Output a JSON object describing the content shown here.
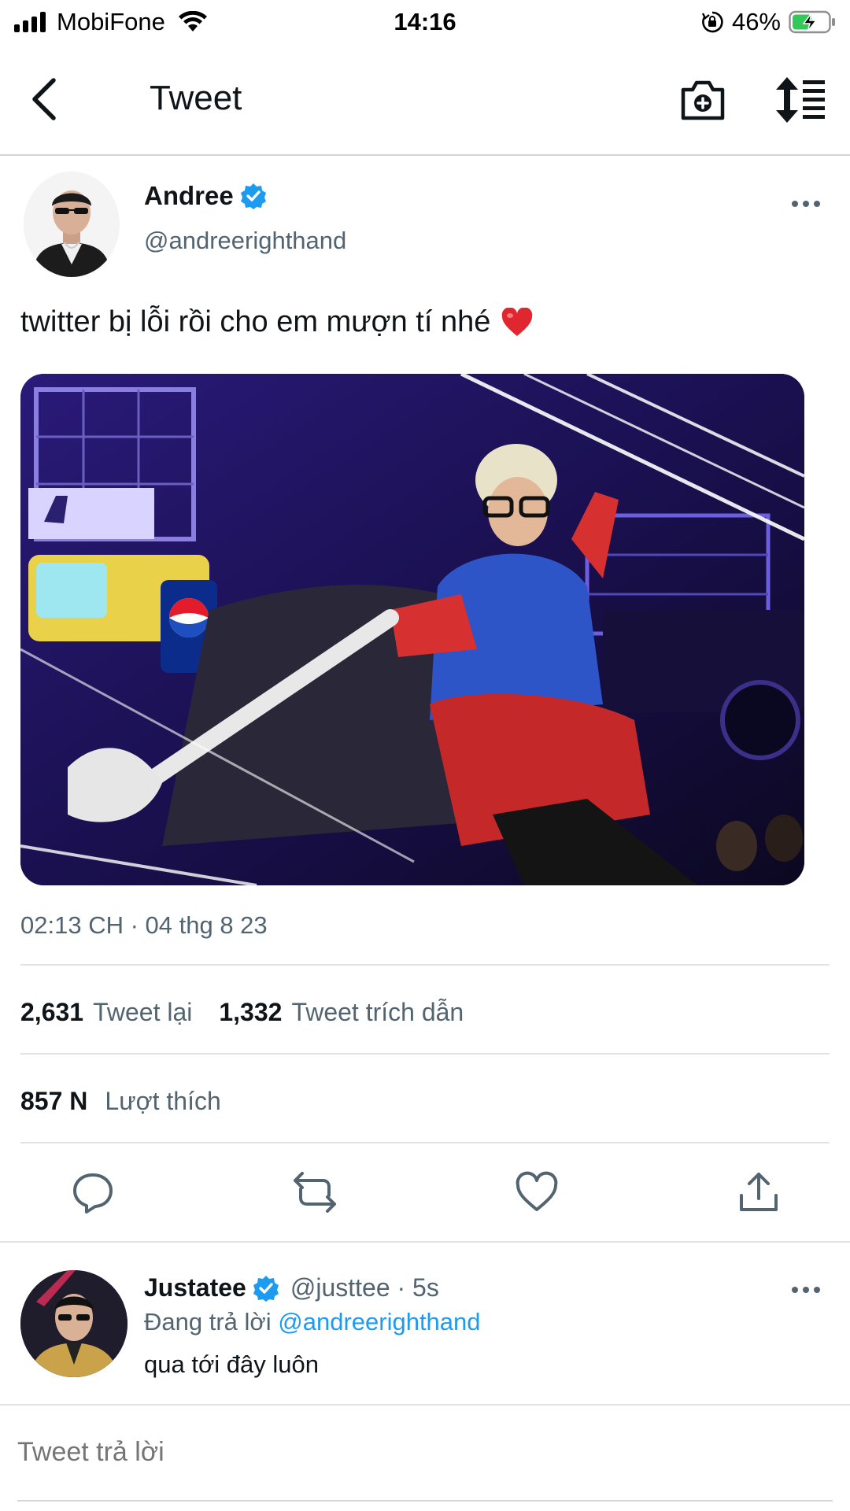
{
  "status_bar": {
    "carrier": "MobiFone",
    "time": "14:16",
    "battery_percent": "46%",
    "icons": [
      "signal-icon",
      "wifi-icon",
      "rotation-lock-icon",
      "battery-charging-icon"
    ]
  },
  "header": {
    "title": "Tweet",
    "icons": [
      "back-arrow-icon",
      "camera-add-icon",
      "sort-icon"
    ]
  },
  "tweet": {
    "author_name": "Andree",
    "author_handle": "@andreerighthand",
    "text": "twitter bị lỗi rồi cho em mượn tí nhé",
    "emoji": "heart-emoji",
    "timestamp": "02:13 CH · 04 thg 8 23",
    "retweets_count": "2,631",
    "retweets_label": "Tweet lại",
    "quotes_count": "1,332",
    "quotes_label": "Tweet trích dẫn",
    "likes_count": "857 N",
    "likes_label": "Lượt thích",
    "actions": [
      "reply-icon",
      "retweet-icon",
      "like-icon",
      "share-icon"
    ]
  },
  "reply": {
    "author_name": "Justatee",
    "meta": "@justtee · 5s",
    "replying_prefix": "Đang trả lời",
    "replying_to": "@andreerighthand",
    "text": "qua tới đây luôn"
  },
  "compose": {
    "placeholder": "Tweet trả lời"
  },
  "colors": {
    "accent": "#1d9bf0",
    "secondary_text": "#536471",
    "primary_text": "#0f1419"
  }
}
